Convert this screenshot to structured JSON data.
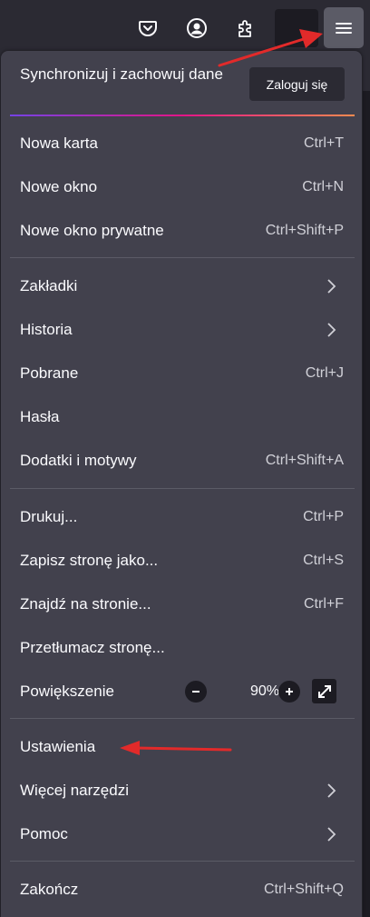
{
  "toolbar": {
    "icons": [
      "pocket-icon",
      "account-icon",
      "extensions-icon",
      "hamburger-menu-icon"
    ]
  },
  "sync": {
    "title": "Synchronizuj i zachowuj dane",
    "login_label": "Zaloguj się"
  },
  "menu": {
    "new_tab": {
      "label": "Nowa karta",
      "shortcut": "Ctrl+T"
    },
    "new_window": {
      "label": "Nowe okno",
      "shortcut": "Ctrl+N"
    },
    "private_window": {
      "label": "Nowe okno prywatne",
      "shortcut": "Ctrl+Shift+P"
    },
    "bookmarks": {
      "label": "Zakładki"
    },
    "history": {
      "label": "Historia"
    },
    "downloads": {
      "label": "Pobrane",
      "shortcut": "Ctrl+J"
    },
    "passwords": {
      "label": "Hasła"
    },
    "addons": {
      "label": "Dodatki i motywy",
      "shortcut": "Ctrl+Shift+A"
    },
    "print": {
      "label": "Drukuj...",
      "shortcut": "Ctrl+P"
    },
    "save_page": {
      "label": "Zapisz stronę jako...",
      "shortcut": "Ctrl+S"
    },
    "find": {
      "label": "Znajdź na stronie...",
      "shortcut": "Ctrl+F"
    },
    "translate": {
      "label": "Przetłumacz stronę..."
    },
    "zoom": {
      "label": "Powiększenie",
      "value": "90%",
      "minus": "−",
      "plus": "+"
    },
    "settings": {
      "label": "Ustawienia"
    },
    "more_tools": {
      "label": "Więcej narzędzi"
    },
    "help": {
      "label": "Pomoc"
    },
    "quit": {
      "label": "Zakończ",
      "shortcut": "Ctrl+Shift+Q"
    }
  },
  "colors": {
    "panel_bg": "#42414d",
    "toolbar_bg": "#2b2a33",
    "annotation_arrow": "#e22a2a"
  }
}
